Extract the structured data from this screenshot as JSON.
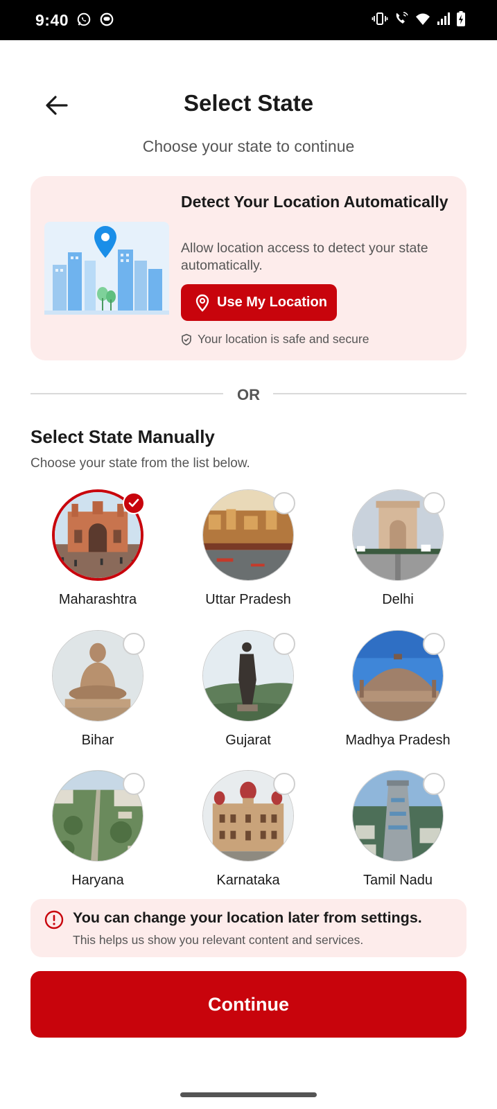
{
  "status_bar": {
    "time": "9:40"
  },
  "header": {
    "title": "Select State",
    "subtitle": "Choose your state to continue"
  },
  "detect": {
    "title": "Detect Your Location Automatically",
    "description": "Allow location access to detect your state automatically.",
    "button_label": "Use My Location",
    "safe_note": "Your location is safe and secure"
  },
  "divider": {
    "label": "OR"
  },
  "manual": {
    "title": "Select State Manually",
    "subtitle": "Choose your state from the list below."
  },
  "states": [
    {
      "name": "Maharashtra",
      "selected": true,
      "image": "gateway-of-india"
    },
    {
      "name": "Uttar Pradesh",
      "selected": false,
      "image": "varanasi-ghats"
    },
    {
      "name": "Delhi",
      "selected": false,
      "image": "india-gate"
    },
    {
      "name": "Bihar",
      "selected": false,
      "image": "buddha-statue"
    },
    {
      "name": "Gujarat",
      "selected": false,
      "image": "statue-of-unity"
    },
    {
      "name": "Madhya Pradesh",
      "selected": false,
      "image": "sanchi-stupa"
    },
    {
      "name": "Haryana",
      "selected": false,
      "image": "aerial-city"
    },
    {
      "name": "Karnataka",
      "selected": false,
      "image": "mysore-palace"
    },
    {
      "name": "Tamil Nadu",
      "selected": false,
      "image": "temple-gopuram"
    }
  ],
  "info": {
    "title": "You can change your location later from settings.",
    "subtitle": "This helps us show you relevant content and services."
  },
  "footer": {
    "continue_label": "Continue"
  },
  "colors": {
    "accent": "#c8040c",
    "card_bg": "#fdeceb",
    "map_pin": "#1a8ee8"
  }
}
